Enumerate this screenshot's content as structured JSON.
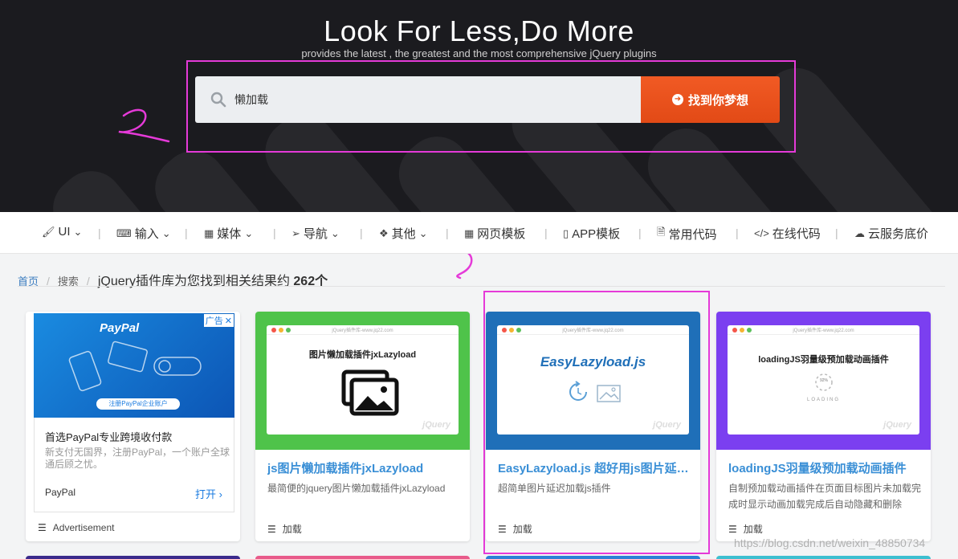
{
  "hero": {
    "title": "Look For Less,Do More",
    "subtitle": "provides the latest , the greatest and the most comprehensive jQuery plugins",
    "search_value": "懒加载",
    "search_button": "找到你梦想"
  },
  "annotations": {
    "mark_2": "2",
    "mark_3": "3",
    "highlight_color": "#e53ad8"
  },
  "nav": {
    "items": [
      {
        "label": "UI",
        "icon": "brush-icon",
        "dropdown": true
      },
      {
        "label": "输入",
        "icon": "keyboard-icon",
        "dropdown": true
      },
      {
        "label": "媒体",
        "icon": "film-icon",
        "dropdown": true
      },
      {
        "label": "导航",
        "icon": "send-icon",
        "dropdown": true
      },
      {
        "label": "其他",
        "icon": "dropbox-icon",
        "dropdown": true
      },
      {
        "label": "网页模板",
        "icon": "grid-icon",
        "dropdown": false
      },
      {
        "label": "APP模板",
        "icon": "mobile-icon",
        "dropdown": false
      },
      {
        "label": "常用代码",
        "icon": "code-file-icon",
        "dropdown": false
      },
      {
        "label": "在线代码",
        "icon": "code-icon",
        "dropdown": false
      },
      {
        "label": "云服务底价",
        "icon": "cloud-icon",
        "dropdown": false
      }
    ],
    "separator": "|"
  },
  "breadcrumb": {
    "home": "首页",
    "search": "搜索",
    "result_prefix": "jQuery插件库为您找到相关结果约",
    "result_count": "262个"
  },
  "ad": {
    "brand_logo": "PayPal",
    "badge": "广告",
    "close": "✕",
    "cta": "注册PayPal企业账户",
    "headline": "首选PayPal专业跨境收付款",
    "text": "新支付无国界，注册PayPal，一个账户全球通后顾之忧。",
    "advertiser": "PayPal",
    "open_label": "打开",
    "footer": "Advertisement"
  },
  "cards": [
    {
      "thumb_color": "#4fc34a",
      "browser_url": "jQuery插件库-www.jq22.com",
      "preview_title": "图片懒加载插件jxLazyload",
      "title": "js图片懒加载插件jxLazyload",
      "title_color": "#3a8fd6",
      "desc": "最简便的jquery图片懒加载插件jxLazyload",
      "tag": "加载"
    },
    {
      "thumb_color": "#1f6fb8",
      "browser_url": "jQuery插件库-www.jq22.com",
      "preview_title": "EasyLazyload.js",
      "title": "EasyLazyload.js 超好用js图片延迟加载插件",
      "title_color": "#3a8fd6",
      "desc": "超简单图片延迟加载js插件",
      "tag": "加载"
    },
    {
      "thumb_color": "#7b3ff0",
      "browser_url": "jQuery插件库-www.jq22.com",
      "preview_title": "loadingJS羽量级预加载动画插件",
      "preview_percent": "92%",
      "preview_loading": "LOADING",
      "title": "loadingJS羽量级预加载动画插件",
      "title_color": "#3a8fd6",
      "desc": "自制预加载动画插件在页面目标图片未加载完成时显示动画加载完成后自动隐藏和删除",
      "tag": "加载"
    }
  ],
  "watermark": "https://blog.csdn.net/weixin_48850734",
  "preview_logo": "jQuery"
}
